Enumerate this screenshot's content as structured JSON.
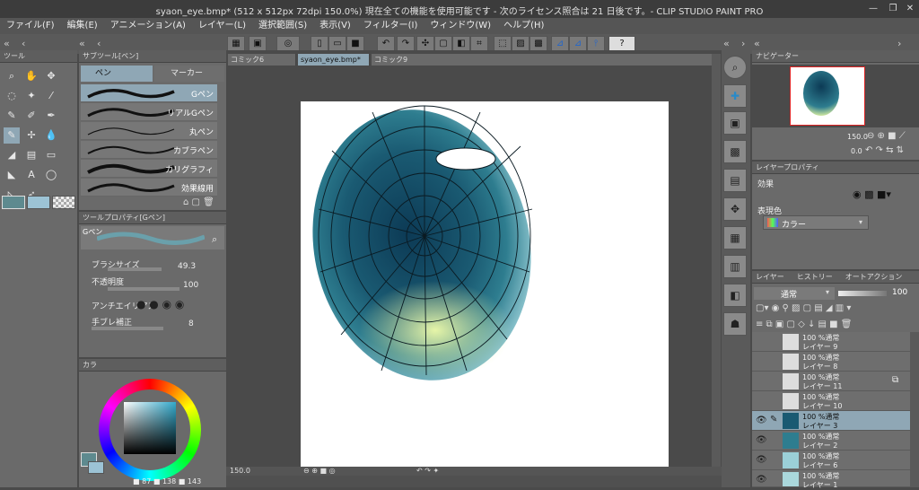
{
  "window": {
    "title": "syaon_eye.bmp* (512 x 512px 72dpi 150.0%)  現在全ての機能を使用可能です - 次のライセンス照合は 21 日後です。- CLIP STUDIO PAINT PRO"
  },
  "menu": [
    "ファイル(F)",
    "編集(E)",
    "アニメーション(A)",
    "レイヤー(L)",
    "選択範囲(S)",
    "表示(V)",
    "フィルター(I)",
    "ウィンドウ(W)",
    "ヘルプ(H)"
  ],
  "tabs": [
    "コミック6",
    "syaon_eye.bmp*",
    "コミック9"
  ],
  "tool_panel": {
    "title": "ツール"
  },
  "subtool_panel": {
    "title": "サブツール[ペン]",
    "tabs": [
      "ペン",
      "マーカー"
    ],
    "brushes": [
      "Gペン",
      "リアルGペン",
      "丸ペン",
      "カブラペン",
      "カリグラフィ",
      "効果線用"
    ]
  },
  "tool_property": {
    "title": "ツールプロパティ[Gペン]",
    "preset": "Gペン",
    "brush_size_label": "ブラシサイズ",
    "brush_size": "49.3",
    "opacity_label": "不透明度",
    "opacity": "100",
    "antialias_label": "アンチエイリアス",
    "stabilization_label": "手ブレ補正",
    "stabilization": "8"
  },
  "color_panel": {
    "title": "カラ",
    "r": "87",
    "g": "138",
    "b": "143",
    "main_color": "#5e8a8f"
  },
  "canvas": {
    "zoom": "150.0"
  },
  "navigator": {
    "title": "ナビゲーター",
    "zoom": "150.0",
    "rotation": "0.0"
  },
  "layer_property": {
    "title": "レイヤープロパティ",
    "effect_label": "効果",
    "expression_label": "表現色",
    "expression_value": "カラー"
  },
  "layer_panel": {
    "tabs": [
      "レイヤー",
      "ヒストリー",
      "オートアクション"
    ],
    "blend": "通常",
    "opacity": "100",
    "layers": [
      {
        "mode": "100 %通常",
        "name": "レイヤー 9"
      },
      {
        "mode": "100 %通常",
        "name": "レイヤー 8"
      },
      {
        "mode": "100 %通常",
        "name": "レイヤー 11"
      },
      {
        "mode": "100 %通常",
        "name": "レイヤー 10"
      },
      {
        "mode": "100 %通常",
        "name": "レイヤー 3"
      },
      {
        "mode": "100 %通常",
        "name": "レイヤー 2"
      },
      {
        "mode": "100 %通常",
        "name": "レイヤー 6"
      },
      {
        "mode": "100 %通常",
        "name": "レイヤー 1"
      }
    ]
  }
}
